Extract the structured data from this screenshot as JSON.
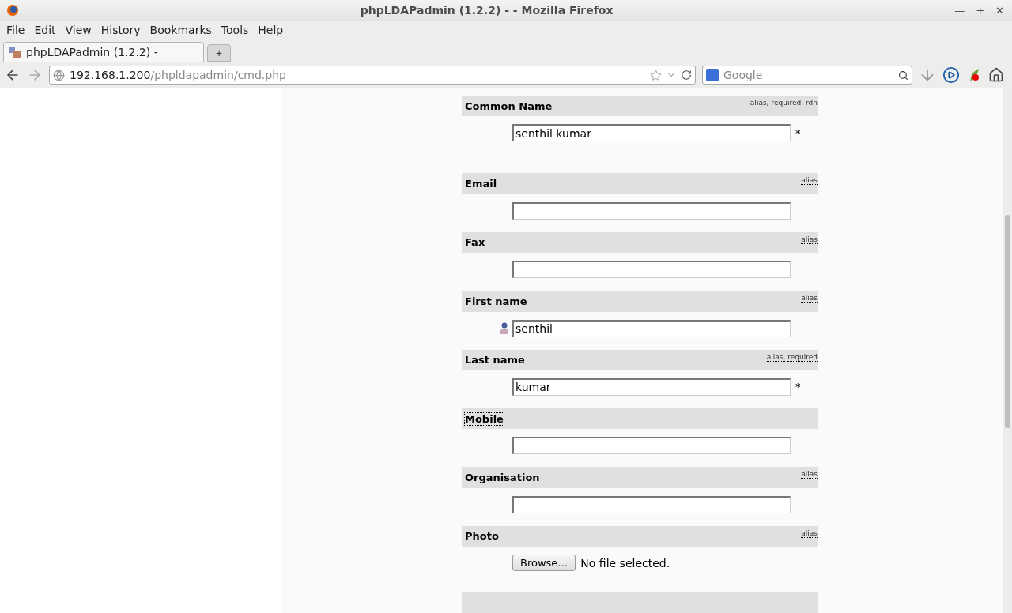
{
  "window": {
    "title": "phpLDAPadmin (1.2.2) - - Mozilla Firefox",
    "buttons": [
      "—",
      "+",
      "✕"
    ]
  },
  "menu": [
    "File",
    "Edit",
    "View",
    "History",
    "Bookmarks",
    "Tools",
    "Help"
  ],
  "tabs": [
    {
      "label": "phpLDAPadmin (1.2.2) -",
      "selected": true
    }
  ],
  "new_tab": "+",
  "address": {
    "host": "192.168.1.200",
    "path": "/phpldapadmin/cmd.php"
  },
  "search": {
    "placeholder": "Google"
  },
  "fields": [
    {
      "kind": "text",
      "label": "Common Name",
      "tags": [
        "alias,",
        "required,",
        "rdn"
      ],
      "value": "senthil kumar",
      "marker": "*",
      "focused": false,
      "user_icon": false
    },
    {
      "kind": "text",
      "label": "Email",
      "tags": [
        "alias"
      ],
      "focused": false,
      "user_icon": false
    },
    {
      "kind": "text",
      "label": "Fax",
      "tags": [
        "alias"
      ],
      "focused": false,
      "user_icon": false
    },
    {
      "kind": "text",
      "label": "First name",
      "tags": [
        "alias"
      ],
      "value": "senthil",
      "focused": false,
      "user_icon": true
    },
    {
      "kind": "text",
      "label": "Last name",
      "tags": [
        "alias,",
        "required"
      ],
      "value": "kumar",
      "marker": "*",
      "focused": false,
      "user_icon": false
    },
    {
      "kind": "text",
      "label": "Mobile",
      "focused": true,
      "user_icon": false
    },
    {
      "kind": "text",
      "label": "Organisation",
      "tags": [
        "alias"
      ],
      "focused": false,
      "user_icon": false
    },
    {
      "kind": "file",
      "label": "Photo",
      "tags": [
        "alias"
      ],
      "button": "Browse…",
      "status": "No file selected.",
      "focused": false,
      "user_icon": false
    },
    {
      "kind": "cut"
    }
  ]
}
